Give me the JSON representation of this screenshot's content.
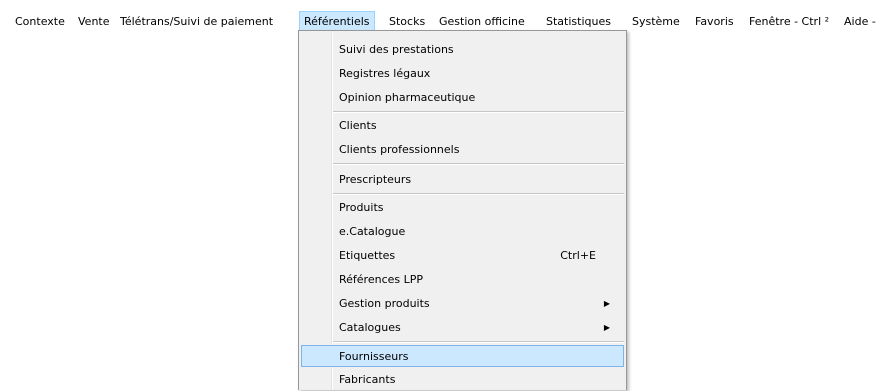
{
  "menubar": {
    "items": [
      {
        "label": "Contexte"
      },
      {
        "label": "Vente"
      },
      {
        "label": "Télétrans/Suivi de paiement"
      },
      {
        "label": "Référentiels"
      },
      {
        "label": "Stocks"
      },
      {
        "label": "Gestion officine"
      },
      {
        "label": "Statistiques"
      },
      {
        "label": "Système"
      },
      {
        "label": "Favoris"
      },
      {
        "label": "Fenêtre - Ctrl ²"
      },
      {
        "label": "Aide -"
      }
    ],
    "active_item": "Référentiels",
    "highlight_color": "#cce8ff"
  },
  "dropdown": {
    "items": [
      {
        "label": "Suivi des prestations"
      },
      {
        "label": "Registres légaux"
      },
      {
        "label": "Opinion pharmaceutique"
      },
      {
        "label": "Clients"
      },
      {
        "label": "Clients professionnels"
      },
      {
        "label": "Prescripteurs"
      },
      {
        "label": "Produits"
      },
      {
        "label": "e.Catalogue"
      },
      {
        "label": "Etiquettes",
        "shortcut": "Ctrl+E"
      },
      {
        "label": "Références LPP"
      },
      {
        "label": "Gestion produits",
        "submenu_icon": "chevron-right-icon"
      },
      {
        "label": "Catalogues",
        "submenu_icon": "chevron-right-icon"
      },
      {
        "label": "Fournisseurs",
        "state": "hover"
      },
      {
        "label": "Fabricants"
      }
    ]
  }
}
